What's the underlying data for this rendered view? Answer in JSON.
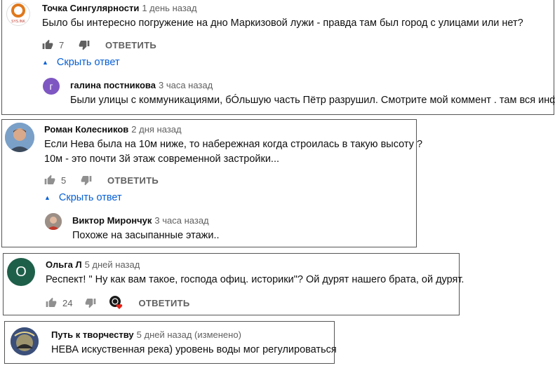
{
  "comments": [
    {
      "author": "Точка Сингулярности",
      "time": "1 день назад",
      "text": "Было бы интересно погружение на дно Маркизовой лужи - правда там был город с улицами или нет?",
      "likes": "7",
      "reply_label": "ОТВЕТИТЬ",
      "toggle_label": "Скрыть ответ",
      "avatar_text": "SYS.INK",
      "reply": {
        "author": "галина постникова",
        "time": "3 часа назад",
        "text": "Были улицы с коммуникациями, бÓльшую часть Пётр разрушил. Смотрите мой коммент . там вся инфа.",
        "avatar_letter": "г",
        "avatar_color": "#7e57c2"
      }
    },
    {
      "author": "Роман Колесников",
      "time": "2 дня назад",
      "text_line1": "Если Нева была на 10м ниже, то набережная когда строилась в такую высоту ?",
      "text_line2": "10м - это почти 3й этаж современной застройки...",
      "likes": "5",
      "reply_label": "ОТВЕТИТЬ",
      "toggle_label": "Скрыть ответ",
      "reply": {
        "author": "Виктор Мирончук",
        "time": "3 часа назад",
        "text": "Похоже на засыпанные этажи.."
      }
    },
    {
      "author": "Ольга Л",
      "time": "5 дней назад",
      "text": "Респект!  \" Ну как вам такое, господа офиц. историки\"? Ой дурят нашего брата, ой дурят.",
      "likes": "24",
      "reply_label": "ОТВЕТИТЬ",
      "avatar_letter": "О",
      "avatar_color": "#1e5f4a"
    },
    {
      "author": "Путь к творчеству",
      "time": "5 дней назад (изменено)",
      "text": "НЕВА искуственная река) уровень воды мог регулироваться"
    }
  ]
}
